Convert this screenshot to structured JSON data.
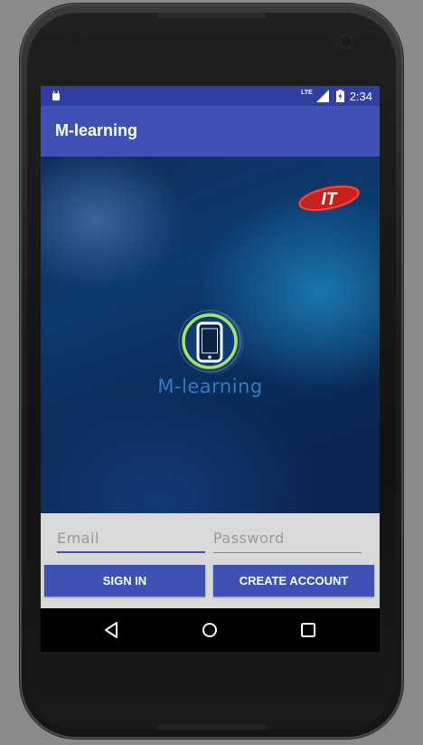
{
  "statusbar": {
    "time": "2:34",
    "network_label": "LTE",
    "icons": [
      "android-notification-icon",
      "signal-icon",
      "battery-icon"
    ]
  },
  "appbar": {
    "title": "M-learning"
  },
  "hero": {
    "corner_logo_text": "IT",
    "app_logo_text": "M-learning"
  },
  "form": {
    "email": {
      "placeholder": "Email",
      "value": ""
    },
    "password": {
      "placeholder": "Password",
      "value": ""
    },
    "sign_in_label": "SIGN IN",
    "create_account_label": "CREATE ACCOUNT"
  },
  "navbar": {
    "icons": [
      "back-icon",
      "home-icon",
      "recents-icon"
    ]
  },
  "colors": {
    "primary": "#3f51b5",
    "primary_dark": "#303f9f",
    "logo_ring": "#a6e36a",
    "logo_text": "#2f7ec2",
    "form_bg": "#d9d9d9"
  }
}
